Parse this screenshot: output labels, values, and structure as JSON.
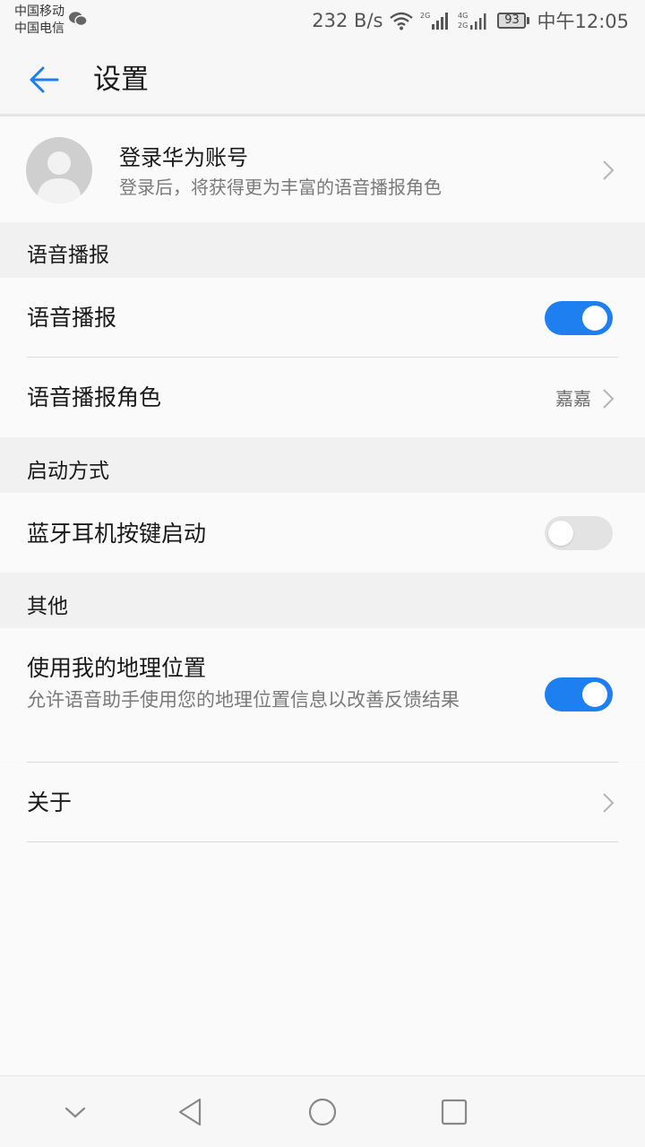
{
  "status_bar": {
    "carrier_1": "中国移动",
    "carrier_2": "中国电信",
    "net_speed": "232 B/s",
    "battery_level": "93",
    "time": "中午12:05"
  },
  "header": {
    "title": "设置"
  },
  "account": {
    "title": "登录华为账号",
    "subtitle": "登录后，将获得更为丰富的语音播报角色"
  },
  "sections": {
    "voice_broadcast": {
      "header": "语音播报",
      "broadcast_toggle_label": "语音播报",
      "broadcast_toggle_on": true,
      "broadcast_role_label": "语音播报角色",
      "broadcast_role_value": "嘉嘉"
    },
    "startup": {
      "header": "启动方式",
      "bluetooth_label": "蓝牙耳机按键启动",
      "bluetooth_on": false
    },
    "other": {
      "header": "其他",
      "location_label": "使用我的地理位置",
      "location_desc": "允许语音助手使用您的地理位置信息以改善反馈结果",
      "location_on": true,
      "about_label": "关于"
    }
  },
  "colors": {
    "accent": "#1e7ff0",
    "toggle_off": "#e3e3e3"
  },
  "icons": {
    "back": "arrow-left-icon",
    "chevron": "chevron-right-icon",
    "nav_collapse": "chevron-down-icon",
    "nav_back": "triangle-back-icon",
    "nav_home": "circle-home-icon",
    "nav_recents": "square-recents-icon"
  }
}
